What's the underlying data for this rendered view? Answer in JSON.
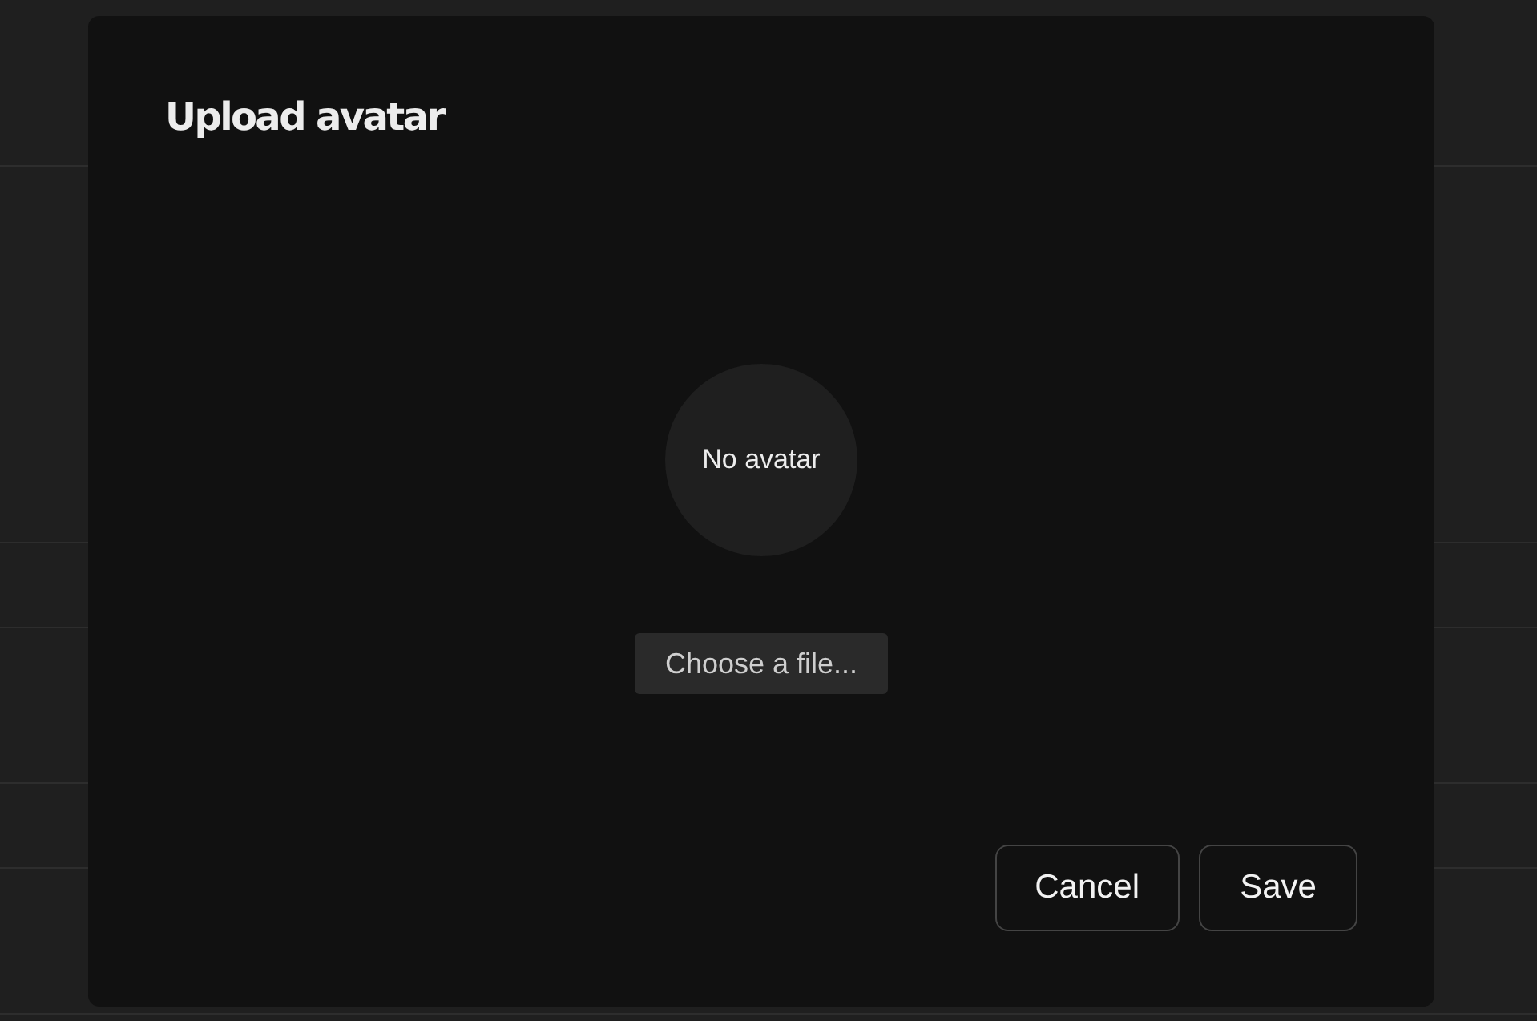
{
  "dialog": {
    "title": "Upload avatar",
    "avatar": {
      "placeholder": "No avatar"
    },
    "file_button": "Choose a file...",
    "buttons": [
      "Cancel",
      "Save"
    ]
  }
}
